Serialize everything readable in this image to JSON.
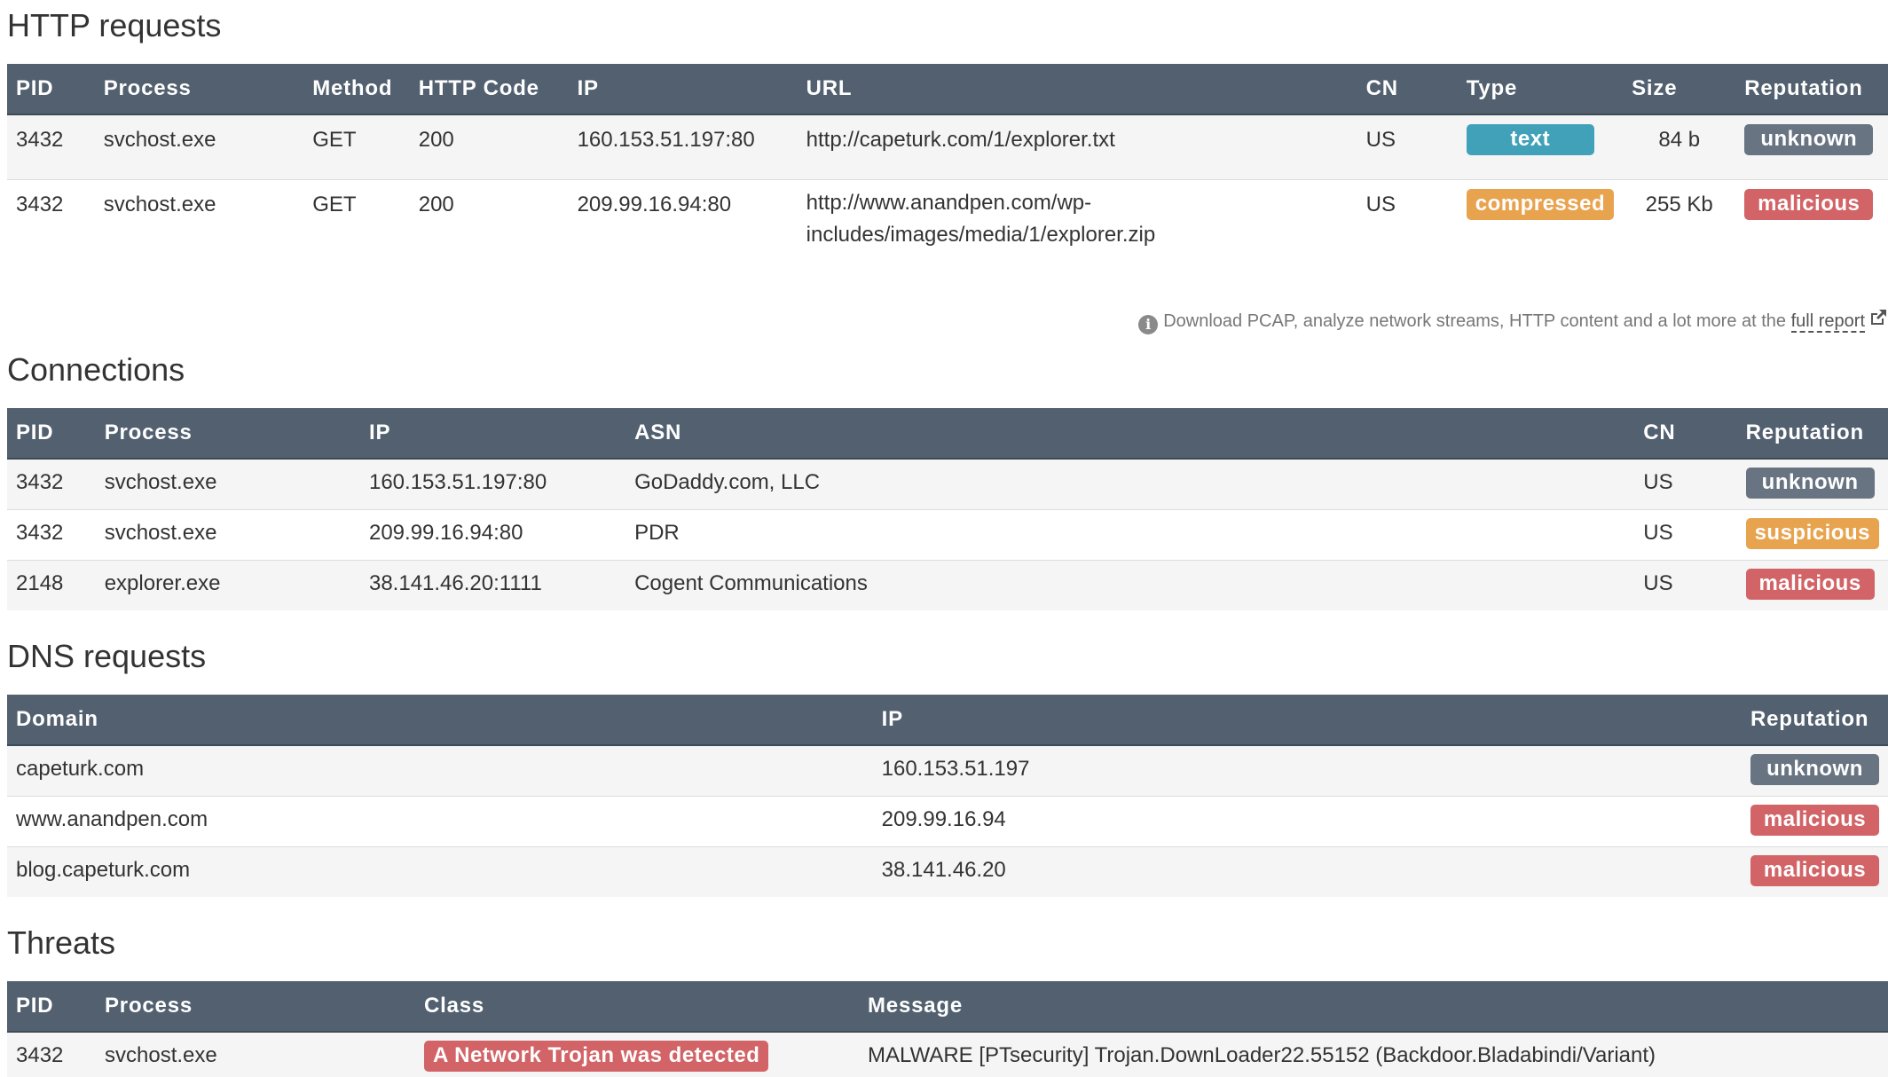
{
  "http": {
    "title": "HTTP requests",
    "headers": [
      "PID",
      "Process",
      "Method",
      "HTTP Code",
      "IP",
      "URL",
      "CN",
      "Type",
      "Size",
      "Reputation"
    ],
    "rows": [
      {
        "pid": "3432",
        "process": "svchost.exe",
        "method": "GET",
        "code": "200",
        "ip": "160.153.51.197:80",
        "url_1": "http://capeturk.com/1/explorer.txt",
        "url_2": "",
        "cn": "US",
        "type": "text",
        "size": "84 b",
        "reputation": "unknown"
      },
      {
        "pid": "3432",
        "process": "svchost.exe",
        "method": "GET",
        "code": "200",
        "ip": "209.99.16.94:80",
        "url_1": "http://www.anandpen.com/wp-",
        "url_2": "includes/images/media/1/explorer.zip",
        "cn": "US",
        "type": "compressed",
        "size": "255 Kb",
        "reputation": "malicious"
      }
    ],
    "note": {
      "icon": "info-icon",
      "text": "Download PCAP, analyze network streams, HTTP content and a lot more at the",
      "link": "full report",
      "link_icon": "external-link-icon"
    }
  },
  "connections": {
    "title": "Connections",
    "headers": [
      "PID",
      "Process",
      "IP",
      "ASN",
      "CN",
      "Reputation"
    ],
    "rows": [
      {
        "pid": "3432",
        "process": "svchost.exe",
        "ip": "160.153.51.197:80",
        "asn": "GoDaddy.com, LLC",
        "cn": "US",
        "reputation": "unknown"
      },
      {
        "pid": "3432",
        "process": "svchost.exe",
        "ip": "209.99.16.94:80",
        "asn": "PDR",
        "cn": "US",
        "reputation": "suspicious"
      },
      {
        "pid": "2148",
        "process": "explorer.exe",
        "ip": "38.141.46.20:1111",
        "asn": "Cogent Communications",
        "cn": "US",
        "reputation": "malicious"
      }
    ]
  },
  "dns": {
    "title": "DNS requests",
    "headers": [
      "Domain",
      "IP",
      "Reputation"
    ],
    "rows": [
      {
        "domain": "capeturk.com",
        "ip": "160.153.51.197",
        "reputation": "unknown"
      },
      {
        "domain": "www.anandpen.com",
        "ip": "209.99.16.94",
        "reputation": "malicious"
      },
      {
        "domain": "blog.capeturk.com",
        "ip": "38.141.46.20",
        "reputation": "malicious"
      }
    ]
  },
  "threats": {
    "title": "Threats",
    "headers": [
      "PID",
      "Process",
      "Class",
      "Message"
    ],
    "rows": [
      {
        "pid": "3432",
        "process": "svchost.exe",
        "class": "A Network Trojan was detected",
        "message": "MALWARE [PTsecurity] Trojan.DownLoader22.55152 (Backdoor.Bladabindi/Variant)"
      }
    ]
  },
  "colors": {
    "header_bg": "#52606f",
    "unknown": "#687482",
    "malicious": "#d26467",
    "suspicious": "#e8a34f",
    "text": "#41a1b9",
    "compressed": "#e8a34f"
  }
}
